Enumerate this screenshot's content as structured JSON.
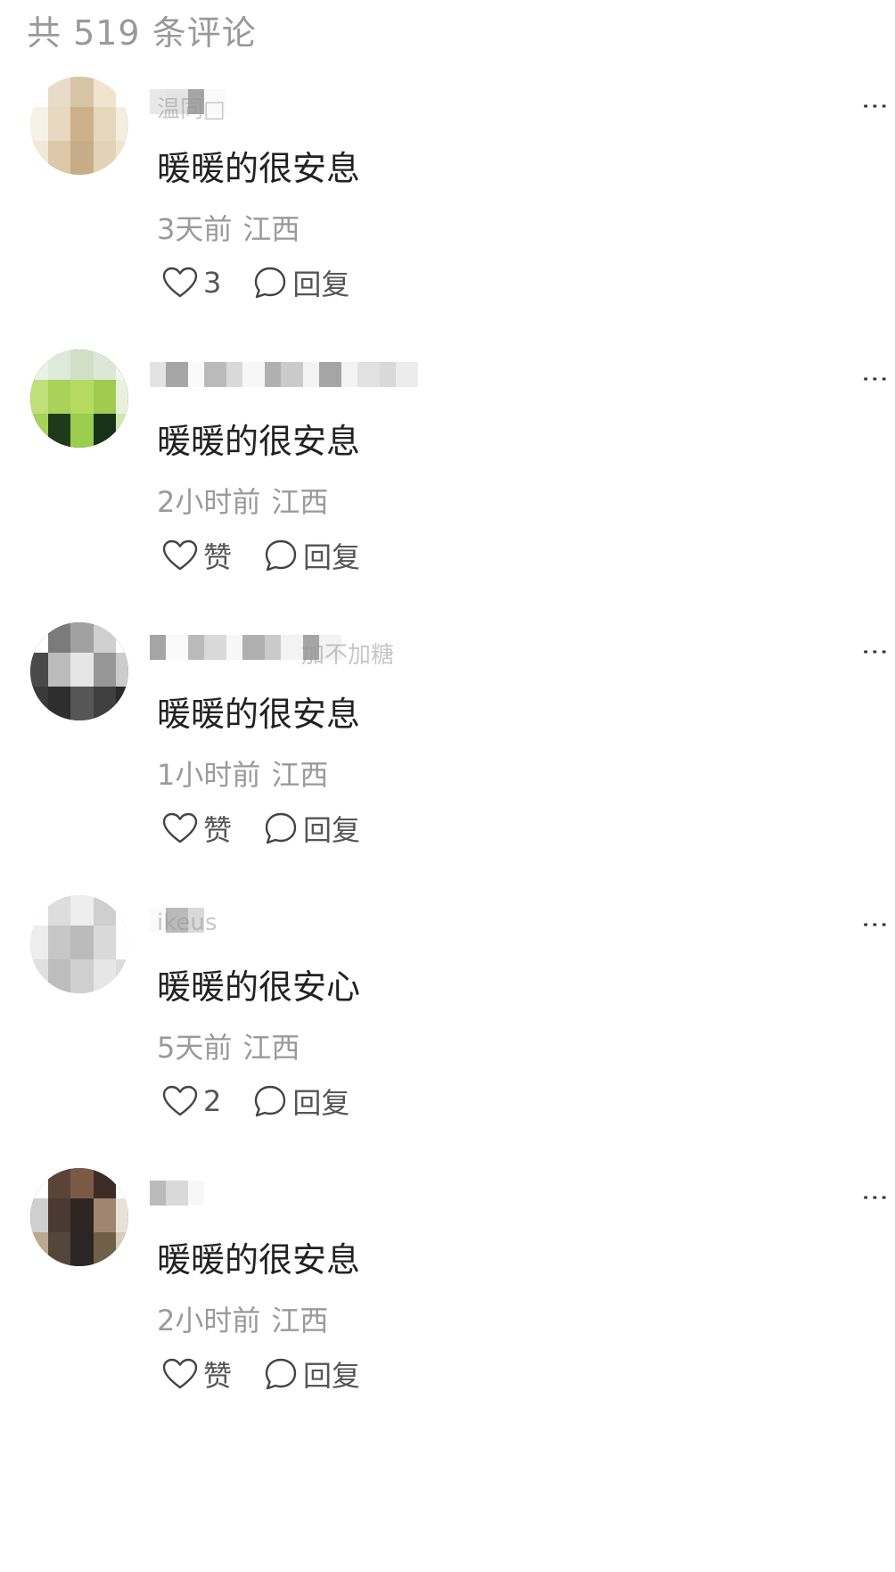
{
  "header": {
    "title": "共 519 条评论"
  },
  "more_label": "⋮",
  "comments": [
    {
      "username": "温同□",
      "text": "暖暖的很安息",
      "time": "3天前",
      "location": "江西",
      "like_label": "3",
      "reply_label": "回复",
      "avatar_colors": [
        "#ffffff",
        "#e8dcc8",
        "#d7c3a6",
        "#f0e4cf",
        "#ffffff",
        "#f7f2e8",
        "#e7d8bf",
        "#cbb08a",
        "#e6d7bb",
        "#f4eede",
        "#f1e9d6",
        "#ddc8a8",
        "#c5ad88",
        "#e3d3b6",
        "#efe6d2"
      ]
    },
    {
      "username": "",
      "text": "暖暖的很安息",
      "time": "2小时前",
      "location": "江西",
      "like_label": "赞",
      "reply_label": "回复",
      "avatar_colors": [
        "#e9f2e4",
        "#dfe9d9",
        "#cfe0c6",
        "#dde7d7",
        "#f2f6ef",
        "#bfe07a",
        "#a8d35a",
        "#b5db63",
        "#9fcc4c",
        "#e8f0de",
        "#a4d25b",
        "#1e3a1a",
        "#9ccd4f",
        "#16331a",
        "#cfe8b0"
      ]
    },
    {
      "username": "加不加糖",
      "text": "暖暖的很安息",
      "time": "1小时前",
      "location": "江西",
      "like_label": "赞",
      "reply_label": "回复",
      "avatar_colors": [
        "#ffffff",
        "#7b7b7b",
        "#a1a1a1",
        "#cfcfcf",
        "#ffffff",
        "#4a4a4a",
        "#bcbcbc",
        "#e6e6e6",
        "#979797",
        "#cccccc",
        "#3a3a3a",
        "#2e2e2e",
        "#565656",
        "#3f3f3f",
        "#2a2a2a"
      ]
    },
    {
      "username": "ikeus",
      "text": "暖暖的很安心",
      "time": "5天前",
      "location": "江西",
      "like_label": "2",
      "reply_label": "回复",
      "avatar_colors": [
        "#ffffff",
        "#dddddd",
        "#eeeeee",
        "#cfcfcf",
        "#ffffff",
        "#ededed",
        "#c6c6c6",
        "#bbbbbb",
        "#d9d9d9",
        "#ffffff",
        "#e0e0e0",
        "#bdbdbd",
        "#cfcfcf",
        "#e6e6e6",
        "#dcdcdc"
      ]
    },
    {
      "username": "",
      "text": "暖暖的很安息",
      "time": "2小时前",
      "location": "江西",
      "like_label": "赞",
      "reply_label": "回复",
      "avatar_colors": [
        "#ffffff",
        "#5b4337",
        "#7a5a47",
        "#3d2c25",
        "#ffffff",
        "#cfcfcf",
        "#4a3a31",
        "#2f2521",
        "#a08671",
        "#e9e1d7",
        "#bba98f",
        "#54463a",
        "#2b2623",
        "#6f6049",
        "#d8ccb8"
      ]
    }
  ]
}
